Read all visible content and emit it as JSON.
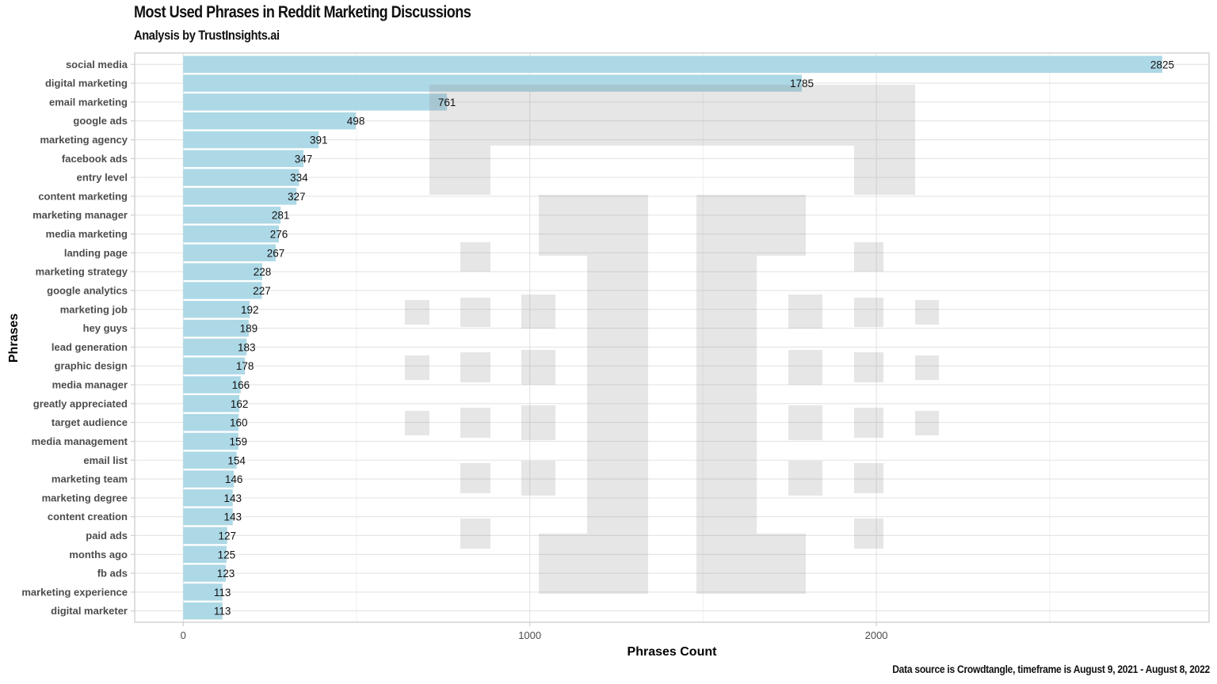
{
  "chart_data": {
    "type": "bar",
    "orientation": "horizontal",
    "title": "Most Used Phrases in Reddit Marketing Discussions",
    "subtitle": "Analysis by TrustInsights.ai",
    "caption": "Data source is Crowdtangle, timeframe is August 9, 2021 - August 8, 2022",
    "xlabel": "Phrases Count",
    "ylabel": "Phrases",
    "xlim": [
      -140,
      2960
    ],
    "x_ticks": [
      0,
      1000,
      2000
    ],
    "x_tick_labels": [
      "0",
      "1000",
      "2000"
    ],
    "x_minor_ticks": [
      500,
      1500,
      2500
    ],
    "grid": true,
    "legend": "none",
    "bar_color": "#add8e6",
    "categories": [
      "social media",
      "digital marketing",
      "email marketing",
      "google ads",
      "marketing agency",
      "facebook ads",
      "entry level",
      "content marketing",
      "marketing manager",
      "media marketing",
      "landing page",
      "marketing strategy",
      "google analytics",
      "marketing job",
      "hey guys",
      "lead generation",
      "graphic design",
      "media manager",
      "greatly appreciated",
      "target audience",
      "media management",
      "email list",
      "marketing team",
      "marketing degree",
      "content creation",
      "paid ads",
      "months ago",
      "fb ads",
      "marketing experience",
      "digital marketer"
    ],
    "values": [
      2825,
      1785,
      761,
      498,
      391,
      347,
      334,
      327,
      281,
      276,
      267,
      228,
      227,
      192,
      189,
      183,
      178,
      166,
      162,
      160,
      159,
      154,
      146,
      143,
      143,
      127,
      125,
      123,
      113,
      113
    ],
    "watermark": "TrustInsights logo (gray pixel-block T)"
  }
}
